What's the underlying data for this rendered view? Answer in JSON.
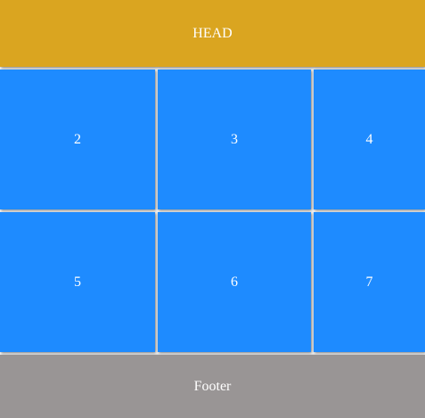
{
  "header": {
    "label": "HEAD"
  },
  "grid": {
    "cells": [
      {
        "label": "2"
      },
      {
        "label": "3"
      },
      {
        "label": "4"
      },
      {
        "label": "5"
      },
      {
        "label": "6"
      },
      {
        "label": "7"
      }
    ]
  },
  "footer": {
    "label": "Footer"
  },
  "colors": {
    "header": "#DAA520",
    "cell": "#1E8BFF",
    "footer": "#999595",
    "text": "#FFFFFF"
  }
}
